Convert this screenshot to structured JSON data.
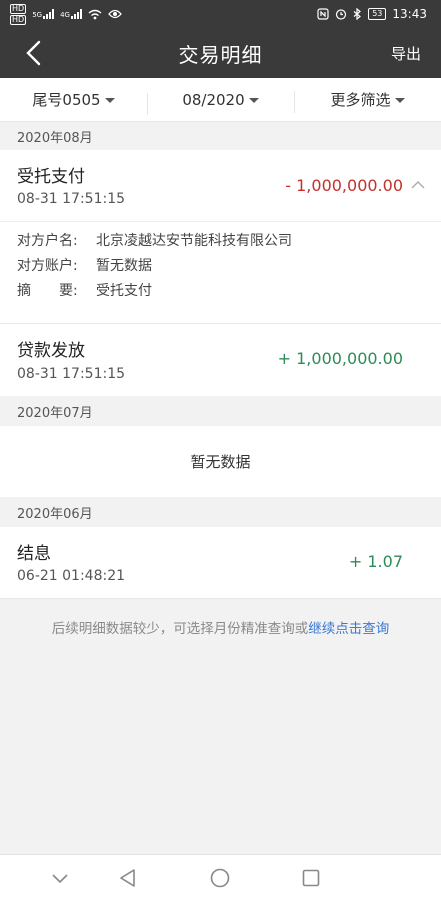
{
  "status_bar": {
    "left_chips": [
      "HD",
      "HD"
    ],
    "network_labels": [
      "5G",
      "4G"
    ],
    "time": "13:43",
    "battery": "53"
  },
  "nav": {
    "back_icon": "chevron-left-icon",
    "title": "交易明细",
    "export_label": "导出"
  },
  "filters": [
    {
      "label": "尾号0505"
    },
    {
      "label": "08/2020"
    },
    {
      "label": "更多筛选"
    }
  ],
  "months": [
    {
      "label": "2020年08月",
      "transactions": [
        {
          "title": "受托支付",
          "time": "08-31 17:51:15",
          "amount": "- 1,000,000.00",
          "expanded": true,
          "details": [
            {
              "label": "对方户名:",
              "value": "北京凌越达安节能科技有限公司"
            },
            {
              "label": "对方账户:",
              "value": "暂无数据"
            },
            {
              "label": "摘　　要:",
              "value": "受托支付"
            }
          ]
        },
        {
          "title": "贷款发放",
          "time": "08-31 17:51:15",
          "amount": "+ 1,000,000.00"
        }
      ]
    },
    {
      "label": "2020年07月",
      "empty_text": "暂无数据"
    },
    {
      "label": "2020年06月",
      "transactions": [
        {
          "title": "结息",
          "time": "06-21 01:48:21",
          "amount": "+ 1.07"
        }
      ]
    }
  ],
  "footer": {
    "note": "后续明细数据较少，可选择月份精准查询或",
    "link": "继续点击查询"
  },
  "colors": {
    "header_bg": "#3a3a3a",
    "negative": "#c4302b",
    "positive": "#2e8b57",
    "link": "#3a78d4"
  }
}
